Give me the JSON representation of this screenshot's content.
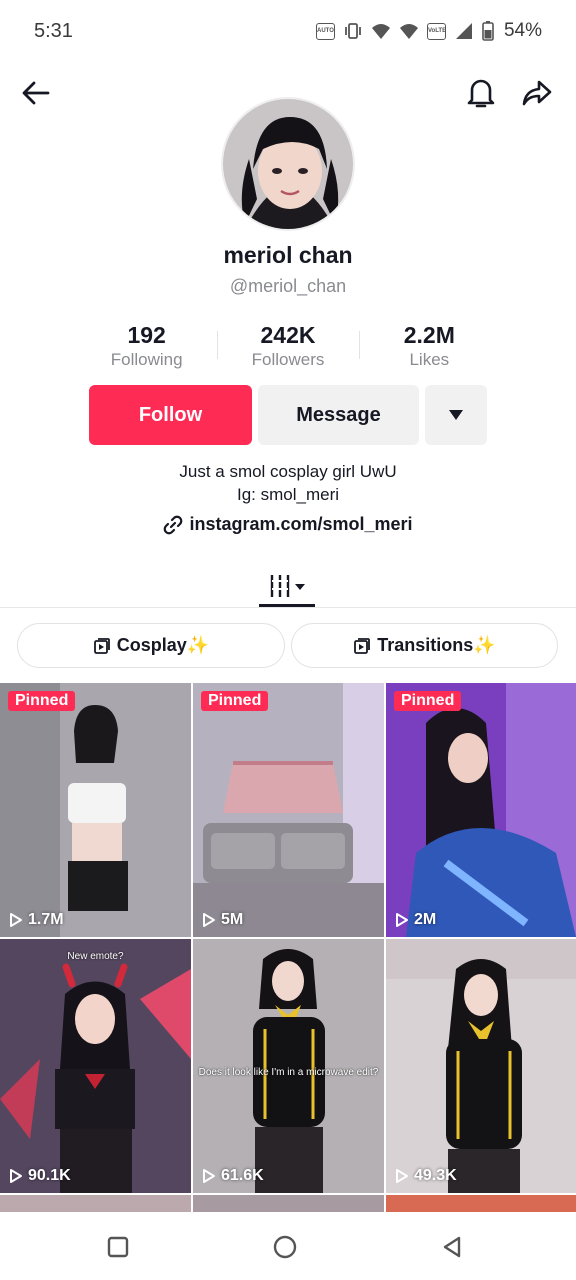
{
  "status_bar": {
    "time": "5:31",
    "battery": "54%"
  },
  "profile": {
    "display_name": "meriol chan",
    "username": "@meriol_chan",
    "stats": [
      {
        "value": "192",
        "label": "Following"
      },
      {
        "value": "242K",
        "label": "Followers"
      },
      {
        "value": "2.2M",
        "label": "Likes"
      }
    ],
    "follow_label": "Follow",
    "message_label": "Message",
    "bio_line1": "Just a smol cosplay girl UwU",
    "bio_line2": "Ig: smol_meri",
    "link": "instagram.com/smol_meri"
  },
  "playlists": [
    {
      "label": "Cosplay✨"
    },
    {
      "label": "Transitions✨"
    }
  ],
  "videos": [
    {
      "pinned": "Pinned",
      "views": "1.7M",
      "caption": ""
    },
    {
      "pinned": "Pinned",
      "views": "5M",
      "caption": ""
    },
    {
      "pinned": "Pinned",
      "views": "2M",
      "caption": ""
    },
    {
      "pinned": "",
      "views": "90.1K",
      "caption": "New emote?"
    },
    {
      "pinned": "",
      "views": "61.6K",
      "caption": "Does it look like I'm in a microwave edit?"
    },
    {
      "pinned": "",
      "views": "49.3K",
      "caption": ""
    }
  ],
  "colors": {
    "accent": "#fe2c55",
    "text": "#161823",
    "muted": "#8a8b91"
  }
}
